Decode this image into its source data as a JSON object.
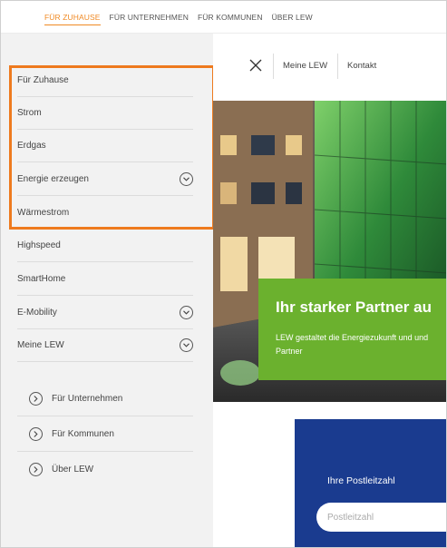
{
  "topnav": {
    "items": [
      "FÜR ZUHAUSE",
      "FÜR UNTERNEHMEN",
      "FÜR KOMMUNEN",
      "ÜBER LEW"
    ]
  },
  "header": {
    "meine_lew": "Meine LEW",
    "kontakt": "Kontakt",
    "close_icon": "close-icon"
  },
  "sidebar": {
    "items": [
      {
        "label": "Für Zuhause",
        "expandable": false
      },
      {
        "label": "Strom",
        "expandable": false
      },
      {
        "label": "Erdgas",
        "expandable": false
      },
      {
        "label": "Energie erzeugen",
        "expandable": true
      },
      {
        "label": "Wärmestrom",
        "expandable": false
      },
      {
        "label": "Highspeed",
        "expandable": false
      },
      {
        "label": "SmartHome",
        "expandable": false
      },
      {
        "label": "E-Mobility",
        "expandable": true
      },
      {
        "label": "Meine LEW",
        "expandable": true
      }
    ],
    "sections": [
      {
        "label": "Für Unternehmen"
      },
      {
        "label": "Für Kommunen"
      },
      {
        "label": "Über LEW"
      }
    ]
  },
  "hero": {
    "title": "Ihr starker Partner au",
    "text": "LEW gestaltet die Energiezukunft und und Partner"
  },
  "postcode": {
    "label": "Ihre Postleitzahl",
    "placeholder": "Postleitzahl"
  },
  "colors": {
    "accent_orange": "#f08a24",
    "highlight_orange": "#ee7a1e",
    "green": "#6bb12e",
    "blue": "#1a3b8f"
  }
}
